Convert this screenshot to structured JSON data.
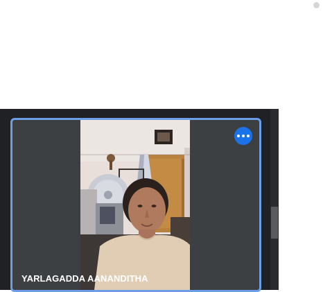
{
  "participant": {
    "name": "YARLAGADDA AANANDITHA",
    "more_options_icon": "more-horizontal-icon"
  },
  "colors": {
    "tile_border": "#6e9de8",
    "more_button": "#1a73e8",
    "meeting_background": "#202124",
    "tile_background": "#3c4043"
  }
}
